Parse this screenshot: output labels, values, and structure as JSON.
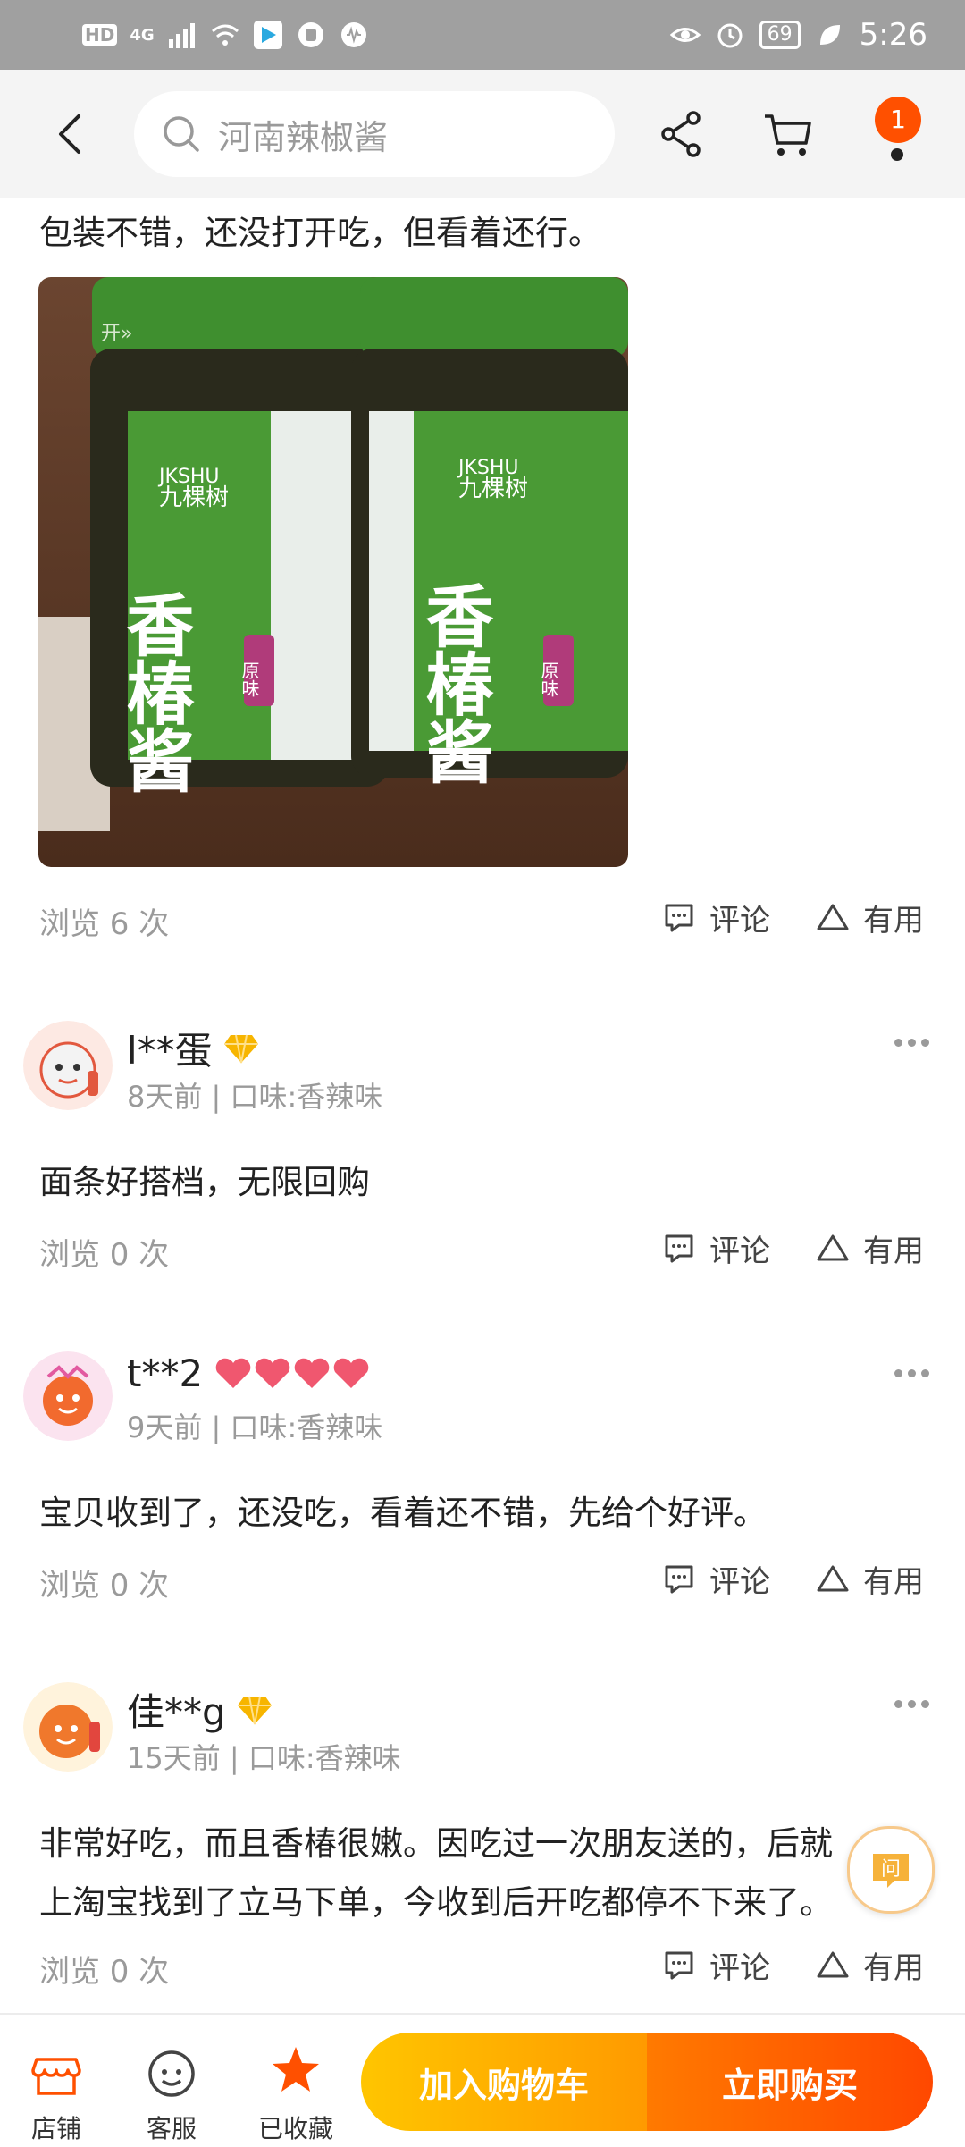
{
  "status_bar": {
    "network_left": "HD",
    "network_type": "4G",
    "battery": "69",
    "time": "5:26"
  },
  "header": {
    "search_placeholder": "河南辣椒酱",
    "notification_badge": "1"
  },
  "reviews": [
    {
      "text": "包装不错，还没打开吃，但看着还行。",
      "photo_labels": {
        "brand_en": "JKSHU",
        "brand_cn": "九棵树",
        "product": "香椿酱",
        "flavor": "原味",
        "lid_text": "开»"
      },
      "views": "浏览 6 次",
      "comment_label": "评论",
      "useful_label": "有用"
    },
    {
      "username": "l**蛋",
      "meta": "8天前 | 口味:香辣味",
      "text": "面条好搭档，无限回购",
      "views": "浏览 0 次",
      "comment_label": "评论",
      "useful_label": "有用"
    },
    {
      "username": "t**2",
      "meta": "9天前 | 口味:香辣味",
      "text": "宝贝收到了，还没吃，看着还不错，先给个好评。",
      "views": "浏览 0 次",
      "comment_label": "评论",
      "useful_label": "有用"
    },
    {
      "username": "佳**g",
      "meta": "15天前 | 口味:香辣味",
      "text_line1": "非常好吃，而且香椿很嫩。因吃过一次朋友送的，后就",
      "text_line2": "上淘宝找到了立马下单，今收到后开吃都停不下来了。",
      "views": "浏览 0 次",
      "comment_label": "评论",
      "useful_label": "有用"
    }
  ],
  "ask_button": "问",
  "bottom_bar": {
    "shop": "店铺",
    "service": "客服",
    "favorited": "已收藏",
    "add_to_cart": "加入购物车",
    "buy_now": "立即购买"
  },
  "colors": {
    "accent": "#ff5000",
    "cart_button": "#ffb000",
    "buy_button": "#ff5a00",
    "muted_text": "#9a9a9a"
  }
}
